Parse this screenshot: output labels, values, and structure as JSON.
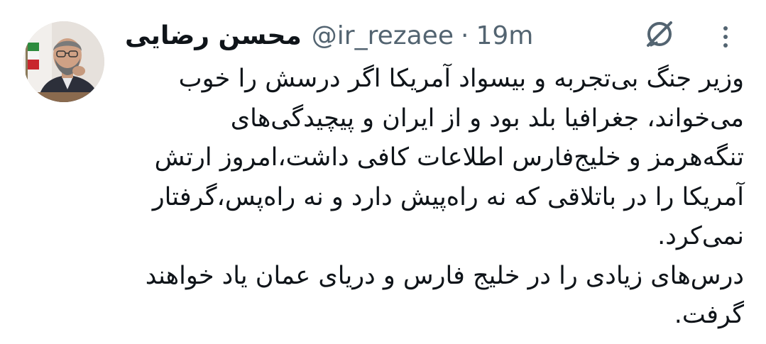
{
  "tweet": {
    "author": {
      "display_name": "محسن رضایی",
      "handle": "@ir_rezaee"
    },
    "separator": "·",
    "time": "19m",
    "text": "وزیر جنگ بی‌تجربه و بیسواد آمریکا اگر درسش را خوب\nمی‌خواند، جغرافیا بلد بود و از ایران و پیچیدگی‌های\nتنگه‌هرمز و خلیج‌فارس اطلاعات کافی داشت،امروز ارتش\nآمریکا را در باتلاقی که نه راه‌پیش دارد و نه راه‌پس،گرفتار\nنمی‌کرد.\nدرس‌های زیادی را در خلیج فارس و دریای عمان یاد خواهند\nگرفت.",
    "icons": {
      "avatar": "profile-photo",
      "grok": "grok-slash-circle-icon",
      "more": "vertical-dots-icon"
    },
    "colors": {
      "text": "#0f1419",
      "secondary": "#536471",
      "background": "#ffffff"
    }
  }
}
